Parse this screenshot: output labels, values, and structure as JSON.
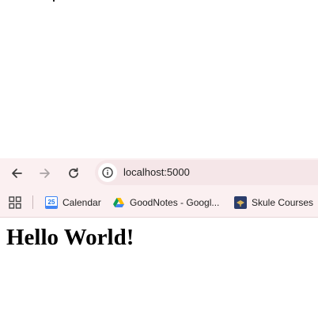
{
  "browser": {
    "address_bar": {
      "url": "localhost:5000"
    },
    "bookmarks": [
      {
        "label": "Calendar",
        "icon": "google-calendar-icon",
        "badge": "25"
      },
      {
        "label": "GoodNotes - Googl...",
        "icon": "google-drive-icon"
      },
      {
        "label": "Skule Courses",
        "icon": "skule-icon"
      }
    ]
  },
  "page": {
    "heading": "Hello World!"
  },
  "colors": {
    "toolbar_bg": "#fbf0f1",
    "omnibox_bg": "#f5e6e8",
    "page_bg": "#ffffff"
  }
}
